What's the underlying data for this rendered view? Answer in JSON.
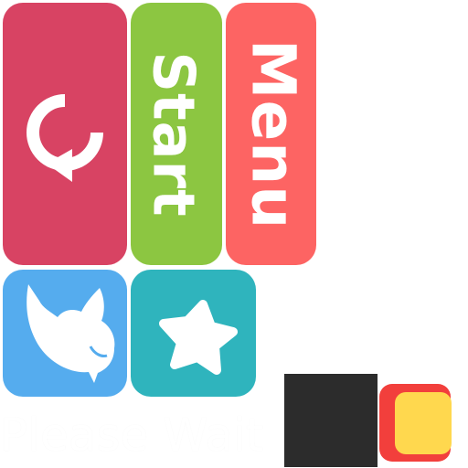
{
  "buttons": {
    "replay": {
      "icon": "replay-icon",
      "color": "#d84363"
    },
    "start": {
      "label": "Start",
      "color": "#8cc641"
    },
    "menu": {
      "label": "Menu",
      "color": "#fd6463"
    },
    "twitter": {
      "icon": "bird-icon",
      "color": "#55acee"
    },
    "rate": {
      "icon": "star-icon",
      "color": "#2fb4bd"
    }
  },
  "loading": {
    "text": "Please Wait"
  },
  "swatches": {
    "dark": "#2c2c2c",
    "checkbox_outer": "#f23f3c",
    "checkbox_inner": "#ffd84e"
  }
}
